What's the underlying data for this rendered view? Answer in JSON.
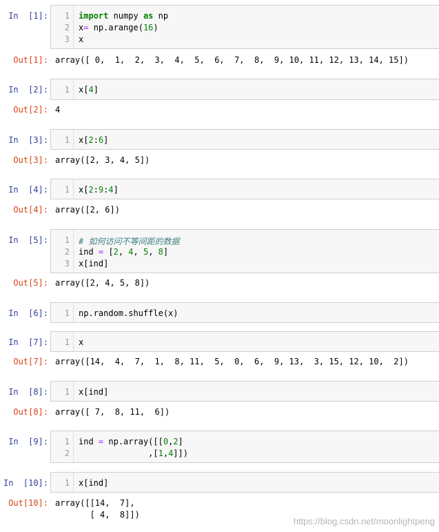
{
  "cells": [
    {
      "in_prompt": "In  [1]:",
      "lines": [
        [
          {
            "t": "import",
            "c": "kw"
          },
          {
            "t": " numpy "
          },
          {
            "t": "as",
            "c": "kw"
          },
          {
            "t": " np"
          }
        ],
        [
          {
            "t": "x"
          },
          {
            "t": "=",
            "c": "op"
          },
          {
            "t": " np.arange("
          },
          {
            "t": "16",
            "c": "num"
          },
          {
            "t": ")"
          }
        ],
        [
          {
            "t": "x"
          }
        ]
      ],
      "out_prompt": "Out[1]:",
      "output": [
        "array([ 0,  1,  2,  3,  4,  5,  6,  7,  8,  9, 10, 11, 12, 13, 14, 15])"
      ]
    },
    {
      "in_prompt": "In  [2]:",
      "lines": [
        [
          {
            "t": "x["
          },
          {
            "t": "4",
            "c": "num"
          },
          {
            "t": "]"
          }
        ]
      ],
      "out_prompt": "Out[2]:",
      "output": [
        "4"
      ]
    },
    {
      "in_prompt": "In  [3]:",
      "lines": [
        [
          {
            "t": "x["
          },
          {
            "t": "2",
            "c": "num"
          },
          {
            "t": ":"
          },
          {
            "t": "6",
            "c": "num"
          },
          {
            "t": "]"
          }
        ]
      ],
      "out_prompt": "Out[3]:",
      "output": [
        "array([2, 3, 4, 5])"
      ]
    },
    {
      "in_prompt": "In  [4]:",
      "lines": [
        [
          {
            "t": "x["
          },
          {
            "t": "2",
            "c": "num"
          },
          {
            "t": ":"
          },
          {
            "t": "9",
            "c": "num"
          },
          {
            "t": ":"
          },
          {
            "t": "4",
            "c": "num"
          },
          {
            "t": "]"
          }
        ]
      ],
      "out_prompt": "Out[4]:",
      "output": [
        "array([2, 6])"
      ]
    },
    {
      "in_prompt": "In  [5]:",
      "lines": [
        [
          {
            "t": "# 如何访问不等间距的数据",
            "c": "cm"
          }
        ],
        [
          {
            "t": "ind "
          },
          {
            "t": "=",
            "c": "op"
          },
          {
            "t": " ["
          },
          {
            "t": "2",
            "c": "num"
          },
          {
            "t": ", "
          },
          {
            "t": "4",
            "c": "num"
          },
          {
            "t": ", "
          },
          {
            "t": "5",
            "c": "num"
          },
          {
            "t": ", "
          },
          {
            "t": "8",
            "c": "num"
          },
          {
            "t": "]"
          }
        ],
        [
          {
            "t": "x[ind]"
          }
        ]
      ],
      "out_prompt": "Out[5]:",
      "output": [
        "array([2, 4, 5, 8])"
      ]
    },
    {
      "in_prompt": "In  [6]:",
      "lines": [
        [
          {
            "t": "np.random.shuffle(x)"
          }
        ]
      ],
      "out_prompt": "",
      "output": []
    },
    {
      "in_prompt": "In  [7]:",
      "lines": [
        [
          {
            "t": "x"
          }
        ]
      ],
      "out_prompt": "Out[7]:",
      "output": [
        "array([14,  4,  7,  1,  8, 11,  5,  0,  6,  9, 13,  3, 15, 12, 10,  2])"
      ]
    },
    {
      "in_prompt": "In  [8]:",
      "lines": [
        [
          {
            "t": "x[ind]"
          }
        ]
      ],
      "out_prompt": "Out[8]:",
      "output": [
        "array([ 7,  8, 11,  6])"
      ]
    },
    {
      "in_prompt": "In  [9]:",
      "lines": [
        [
          {
            "t": "ind "
          },
          {
            "t": "=",
            "c": "op"
          },
          {
            "t": " np.array([["
          },
          {
            "t": "0",
            "c": "num"
          },
          {
            "t": ","
          },
          {
            "t": "2",
            "c": "num"
          },
          {
            "t": "]"
          }
        ],
        [
          {
            "t": "              ,["
          },
          {
            "t": "1",
            "c": "num"
          },
          {
            "t": ","
          },
          {
            "t": "4",
            "c": "num"
          },
          {
            "t": "]])"
          }
        ]
      ],
      "out_prompt": "",
      "output": []
    },
    {
      "in_prompt": "In  [10]:",
      "lines": [
        [
          {
            "t": "x[ind]"
          }
        ]
      ],
      "out_prompt": "Out[10]:",
      "output": [
        "array([[14,  7],",
        "       [ 4,  8]])"
      ]
    }
  ],
  "watermark": "https://blog.csdn.net/moonlightpeng"
}
